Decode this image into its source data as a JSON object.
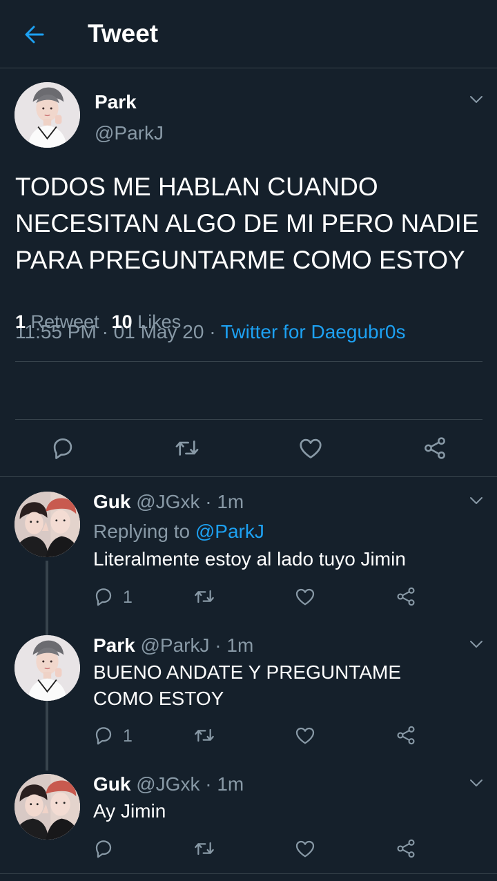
{
  "header": {
    "title": "Tweet"
  },
  "main_tweet": {
    "name": "Park",
    "handle": "@ParkJ",
    "text": "TODOS ME HABLAN CUANDO NECESITAN ALGO DE MI PERO NADIE PARA PREGUNTARME COMO ESTOY",
    "time": "11:55 PM",
    "separator": "·",
    "date": "01 May 20",
    "source": "Twitter for Daegubr0s",
    "retweet_count": "1",
    "retweet_label": "Retweet",
    "like_count": "10",
    "like_label": "Likes"
  },
  "replies": [
    {
      "name": "Guk",
      "handle": "@JGxk",
      "time": "· 1m",
      "replying_prefix": "Replying to",
      "replying_to": "@ParkJ",
      "text": "Literalmente estoy al lado tuyo Jimin",
      "reply_count": "1"
    },
    {
      "name": "Park",
      "handle": "@ParkJ",
      "time": "· 1m",
      "text": "BUENO ANDATE Y PREGUNTAME COMO ESTOY",
      "reply_count": "1"
    },
    {
      "name": "Guk",
      "handle": "@JGxk",
      "time": "· 1m",
      "text": "Ay Jimin",
      "reply_count": ""
    }
  ],
  "icons": {
    "back": "arrow-left-icon",
    "more": "chevron-down-icon",
    "reply": "speech-bubble-icon",
    "retweet": "retweet-icon",
    "like": "heart-icon",
    "share": "share-icon"
  },
  "colors": {
    "background": "#15202b",
    "accent": "#1da1f2",
    "muted": "#8899a6",
    "divider": "#38444d"
  }
}
